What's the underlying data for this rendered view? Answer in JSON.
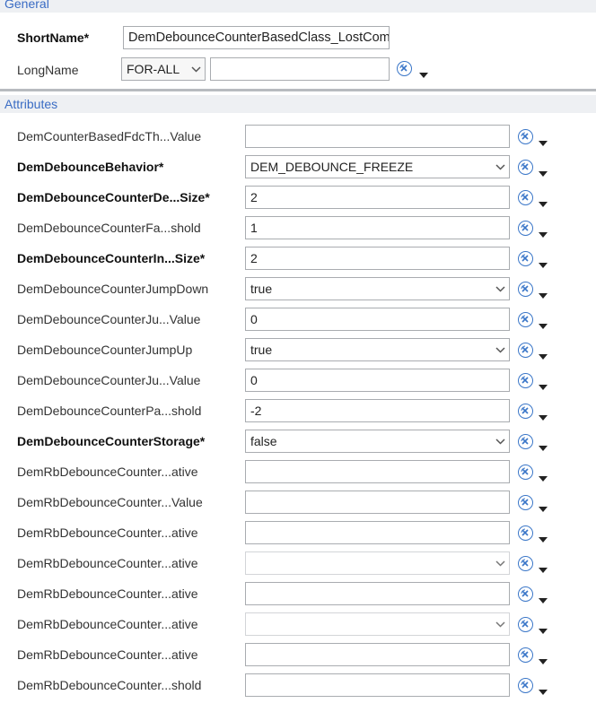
{
  "general": {
    "header": "General",
    "short_name_label": "ShortName*",
    "short_name_value": "DemDebounceCounterBasedClass_LostCom",
    "long_name_label": "LongName",
    "language_value": "FOR-ALL",
    "long_name_value": ""
  },
  "attributes": {
    "header": "Attributes",
    "rows": [
      {
        "label": "DemCounterBasedFdcTh...Value",
        "value": "",
        "type": "text",
        "required": false
      },
      {
        "label": "DemDebounceBehavior*",
        "value": "DEM_DEBOUNCE_FREEZE",
        "type": "combo",
        "required": true
      },
      {
        "label": "DemDebounceCounterDe...Size*",
        "value": "2",
        "type": "text",
        "required": true
      },
      {
        "label": "DemDebounceCounterFa...shold",
        "value": "1",
        "type": "text",
        "required": false
      },
      {
        "label": "DemDebounceCounterIn...Size*",
        "value": "2",
        "type": "text",
        "required": true
      },
      {
        "label": "DemDebounceCounterJumpDown",
        "value": "true",
        "type": "combo",
        "required": false
      },
      {
        "label": "DemDebounceCounterJu...Value",
        "value": "0",
        "type": "text",
        "required": false
      },
      {
        "label": "DemDebounceCounterJumpUp",
        "value": "true",
        "type": "combo",
        "required": false
      },
      {
        "label": "DemDebounceCounterJu...Value",
        "value": "0",
        "type": "text",
        "required": false
      },
      {
        "label": "DemDebounceCounterPa...shold",
        "value": "-2",
        "type": "text",
        "required": false
      },
      {
        "label": "DemDebounceCounterStorage*",
        "value": "false",
        "type": "combo",
        "required": true
      },
      {
        "label": "DemRbDebounceCounter...ative",
        "value": "",
        "type": "text",
        "required": false
      },
      {
        "label": "DemRbDebounceCounter...Value",
        "value": "",
        "type": "text",
        "required": false
      },
      {
        "label": "DemRbDebounceCounter...ative",
        "value": "",
        "type": "text",
        "required": false
      },
      {
        "label": "DemRbDebounceCounter...ative",
        "value": "",
        "type": "combo-disabled",
        "required": false
      },
      {
        "label": "DemRbDebounceCounter...ative",
        "value": "",
        "type": "text",
        "required": false
      },
      {
        "label": "DemRbDebounceCounter...ative",
        "value": "",
        "type": "combo-disabled",
        "required": false
      },
      {
        "label": "DemRbDebounceCounter...ative",
        "value": "",
        "type": "text",
        "required": false
      },
      {
        "label": "DemRbDebounceCounter...shold",
        "value": "",
        "type": "text",
        "required": false
      }
    ]
  },
  "icons": {
    "reset": "reset-default-icon",
    "dropdown": "chevron-down-icon"
  },
  "colors": {
    "header_text": "#3a6cc4",
    "reset_icon": "#3a76c8"
  }
}
